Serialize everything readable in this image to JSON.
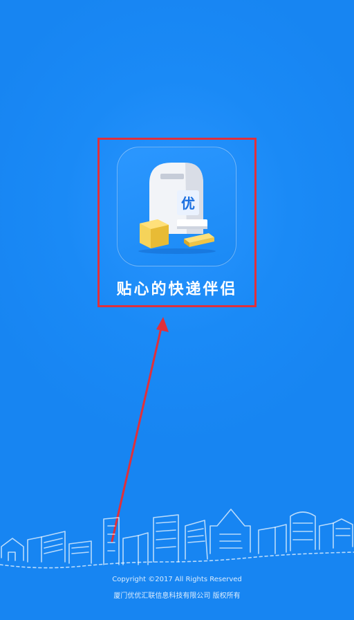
{
  "splash": {
    "tagline": "贴心的快递伴侣",
    "copyright": "Copyright ©2017 All Rights Reserved",
    "company": "厦门优优汇联信息科技有限公司 版权所有"
  },
  "app_icon": {
    "name": "mailbox-icon",
    "mailbox_label": "优"
  },
  "colors": {
    "background": "#1a8af6",
    "highlight": "#e0303b",
    "package": "#f5d35a",
    "text": "#ffffff"
  }
}
